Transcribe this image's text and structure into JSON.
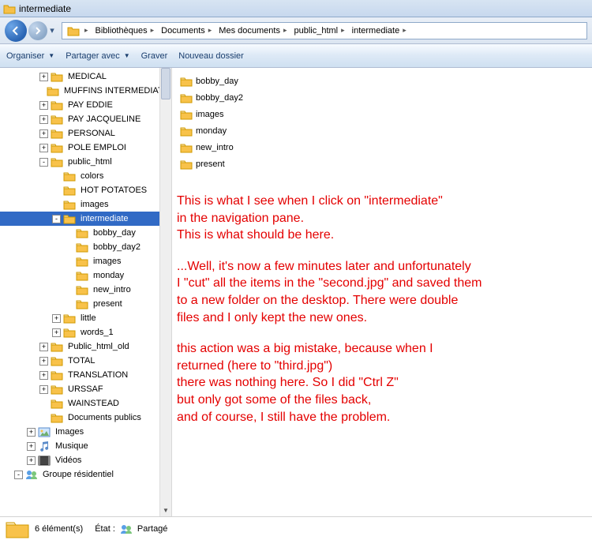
{
  "window_title": "intermediate",
  "breadcrumbs": [
    "Bibliothèques",
    "Documents",
    "Mes documents",
    "public_html",
    "intermediate"
  ],
  "commands": {
    "organize": "Organiser",
    "share": "Partager avec",
    "burn": "Graver",
    "newfolder": "Nouveau dossier"
  },
  "tree": [
    {
      "label": "MEDICAL",
      "depth": 1,
      "exp": "+"
    },
    {
      "label": "MUFFINS INTERMEDIATE",
      "depth": 1,
      "exp": ""
    },
    {
      "label": "PAY EDDIE",
      "depth": 1,
      "exp": "+"
    },
    {
      "label": "PAY JACQUELINE",
      "depth": 1,
      "exp": "+"
    },
    {
      "label": "PERSONAL",
      "depth": 1,
      "exp": "+"
    },
    {
      "label": "POLE EMPLOI",
      "depth": 1,
      "exp": "+"
    },
    {
      "label": "public_html",
      "depth": 1,
      "exp": "-"
    },
    {
      "label": "colors",
      "depth": 2,
      "exp": ""
    },
    {
      "label": "HOT POTATOES",
      "depth": 2,
      "exp": ""
    },
    {
      "label": "images",
      "depth": 2,
      "exp": ""
    },
    {
      "label": "intermediate",
      "depth": 2,
      "exp": "-",
      "selected": true
    },
    {
      "label": "bobby_day",
      "depth": 3,
      "exp": ""
    },
    {
      "label": "bobby_day2",
      "depth": 3,
      "exp": ""
    },
    {
      "label": "images",
      "depth": 3,
      "exp": ""
    },
    {
      "label": "monday",
      "depth": 3,
      "exp": ""
    },
    {
      "label": "new_intro",
      "depth": 3,
      "exp": ""
    },
    {
      "label": "present",
      "depth": 3,
      "exp": ""
    },
    {
      "label": "little",
      "depth": 2,
      "exp": "+"
    },
    {
      "label": "words_1",
      "depth": 2,
      "exp": "+"
    },
    {
      "label": "Public_html_old",
      "depth": 1,
      "exp": "+"
    },
    {
      "label": "TOTAL",
      "depth": 1,
      "exp": "+"
    },
    {
      "label": "TRANSLATION",
      "depth": 1,
      "exp": "+"
    },
    {
      "label": "URSSAF",
      "depth": 1,
      "exp": "+"
    },
    {
      "label": "WAINSTEAD",
      "depth": 1,
      "exp": ""
    },
    {
      "label": "Documents publics",
      "depth": 1,
      "exp": ""
    },
    {
      "label": "Images",
      "depth": 0,
      "exp": "+",
      "icon": "pic"
    },
    {
      "label": "Musique",
      "depth": 0,
      "exp": "+",
      "icon": "mus"
    },
    {
      "label": "Vidéos",
      "depth": 0,
      "exp": "+",
      "icon": "vid"
    },
    {
      "label": "Groupe résidentiel",
      "depth": -1,
      "exp": "-",
      "icon": "grp"
    }
  ],
  "files": [
    "bobby_day",
    "bobby_day2",
    "images",
    "monday",
    "new_intro",
    "present"
  ],
  "annotation": {
    "p1": "This is what I see when I click on \"intermediate\"\nin the navigation pane.\nThis is what should be here.",
    "p2": "...Well, it's now a few minutes later and unfortunately\nI \"cut\" all the items in the \"second.jpg\" and saved them\nto a new folder on the desktop. There were double\nfiles and I only kept the new ones.",
    "p3": "this action was a big mistake, because when I\nreturned (here to \"third.jpg\")\nthere was nothing here. So I did \"Ctrl Z\"\nbut only got some of the files back,\nand of course, I still have the problem."
  },
  "status": {
    "count": "6 élément(s)",
    "state_label": "État :",
    "shared": "Partagé"
  }
}
